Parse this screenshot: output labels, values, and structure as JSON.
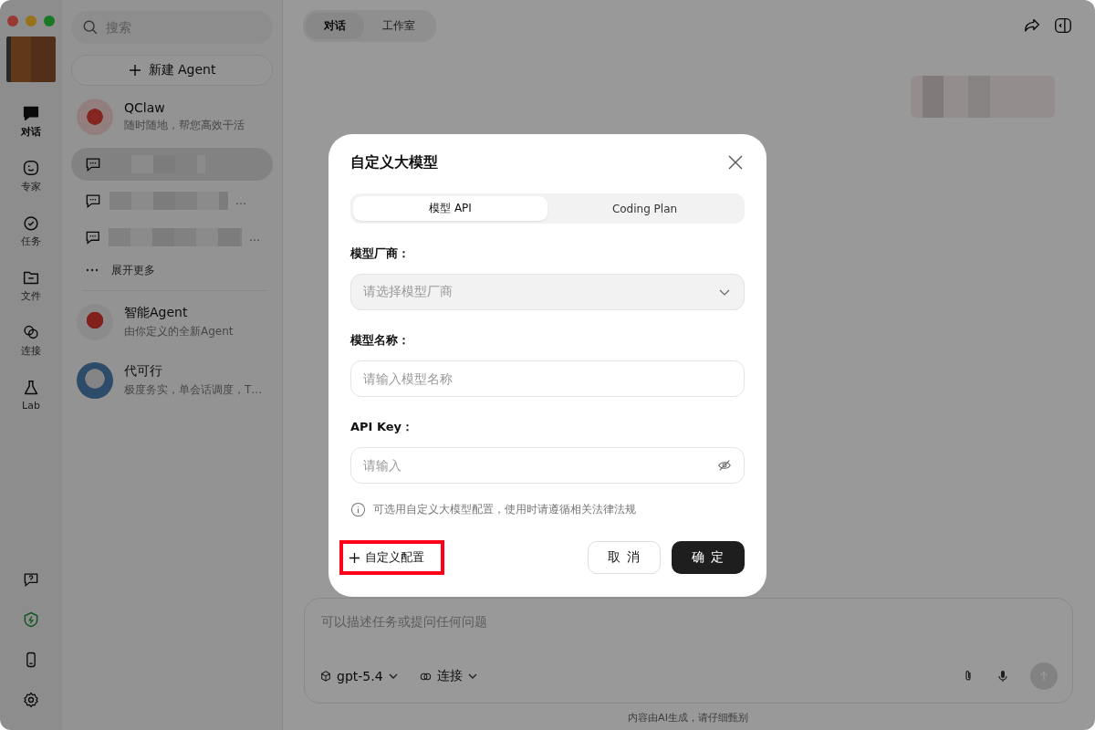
{
  "rail": {
    "items": [
      {
        "kind": "chat",
        "label": "对话",
        "selected": true
      },
      {
        "kind": "expert",
        "label": "专家",
        "selected": false
      },
      {
        "kind": "task",
        "label": "任务",
        "selected": false
      },
      {
        "kind": "file",
        "label": "文件",
        "selected": false
      },
      {
        "kind": "link",
        "label": "连接",
        "selected": false
      },
      {
        "kind": "lab",
        "label": "Lab",
        "selected": false
      }
    ],
    "bottom_icons": [
      {
        "kind": "help"
      },
      {
        "kind": "shield"
      },
      {
        "kind": "phone"
      },
      {
        "kind": "settings"
      }
    ]
  },
  "list": {
    "search": {
      "placeholder": "搜索"
    },
    "new_button": "新建 Agent",
    "agents_top": [
      {
        "kind": "lobster",
        "name": "QClaw",
        "subtitle": "随时随地，帮您高效干活"
      }
    ],
    "chats": [
      {
        "selected": true
      },
      {
        "selected": false,
        "ellipsis": "…"
      },
      {
        "selected": false,
        "ellipsis": "…"
      }
    ],
    "expand": "展开更多",
    "agents": [
      {
        "kind": "robot",
        "name": "智能Agent",
        "subtitle": "由你定义的全新Agent"
      },
      {
        "kind": "person",
        "name": "代可行",
        "subtitle": "极度务实，单会话调度，T…"
      }
    ]
  },
  "main": {
    "tabs": [
      {
        "label": "对话",
        "selected": true
      },
      {
        "label": "工作室",
        "selected": false
      }
    ],
    "composer": {
      "placeholder": "可以描述任务或提问任何问题",
      "model": "gpt-5.4",
      "connect": "连接"
    },
    "footer_note": "内容由AI生成，请仔细甄别"
  },
  "dialog": {
    "title": "自定义大模型",
    "tabs": [
      {
        "label": "模型 API",
        "selected": true
      },
      {
        "label": "Coding Plan",
        "selected": false
      }
    ],
    "fields": [
      {
        "kind": "select",
        "label": "模型厂商：",
        "placeholder": "请选择模型厂商"
      },
      {
        "kind": "text",
        "label": "模型名称：",
        "placeholder": "请输入模型名称"
      },
      {
        "kind": "password",
        "label": "API Key：",
        "placeholder": "请输入"
      }
    ],
    "notice": "可选用自定义大模型配置，使用时请遵循相关法律法规",
    "custom_button": "自定义配置",
    "cancel": "取 消",
    "confirm": "确 定"
  }
}
